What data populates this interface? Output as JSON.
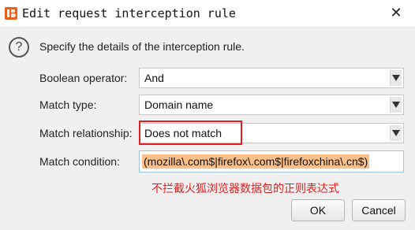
{
  "window": {
    "title": "Edit request interception rule",
    "close_glyph": "✕",
    "app_icon": "burp-logo-icon",
    "accent": "#e8601c"
  },
  "dialog": {
    "intro": "Specify the details of the interception rule.",
    "help_glyph": "?"
  },
  "fields": {
    "boolean_operator": {
      "label": "Boolean operator:",
      "value": "And"
    },
    "match_type": {
      "label": "Match type:",
      "value": "Domain name"
    },
    "match_relationship": {
      "label": "Match relationship:",
      "value": "Does not match"
    },
    "match_condition": {
      "label": "Match condition:",
      "value": "(mozilla\\.com$|firefox\\.com$|firefoxchina\\.cn$)"
    }
  },
  "annotation": {
    "text": "不拦截火狐浏览器数据包的正则表达式",
    "color": "#e02020"
  },
  "buttons": {
    "ok": "OK",
    "cancel": "Cancel"
  }
}
